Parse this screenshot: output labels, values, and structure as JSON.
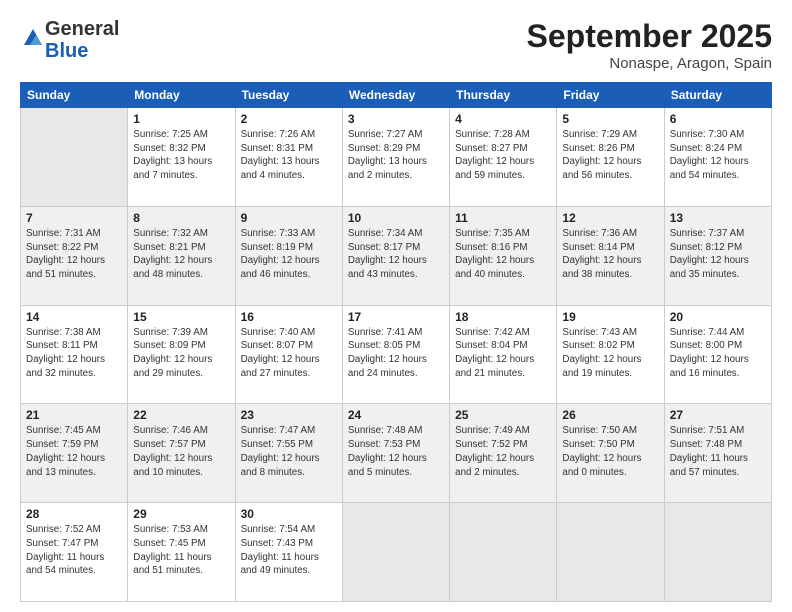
{
  "header": {
    "logo_general": "General",
    "logo_blue": "Blue",
    "month_title": "September 2025",
    "location": "Nonaspe, Aragon, Spain"
  },
  "weekdays": [
    "Sunday",
    "Monday",
    "Tuesday",
    "Wednesday",
    "Thursday",
    "Friday",
    "Saturday"
  ],
  "rows": [
    {
      "cells": [
        {
          "empty": true
        },
        {
          "day": "1",
          "sunrise": "7:25 AM",
          "sunset": "8:32 PM",
          "daylight": "13 hours and 7 minutes."
        },
        {
          "day": "2",
          "sunrise": "7:26 AM",
          "sunset": "8:31 PM",
          "daylight": "13 hours and 4 minutes."
        },
        {
          "day": "3",
          "sunrise": "7:27 AM",
          "sunset": "8:29 PM",
          "daylight": "13 hours and 2 minutes."
        },
        {
          "day": "4",
          "sunrise": "7:28 AM",
          "sunset": "8:27 PM",
          "daylight": "12 hours and 59 minutes."
        },
        {
          "day": "5",
          "sunrise": "7:29 AM",
          "sunset": "8:26 PM",
          "daylight": "12 hours and 56 minutes."
        },
        {
          "day": "6",
          "sunrise": "7:30 AM",
          "sunset": "8:24 PM",
          "daylight": "12 hours and 54 minutes."
        }
      ]
    },
    {
      "cells": [
        {
          "day": "7",
          "sunrise": "7:31 AM",
          "sunset": "8:22 PM",
          "daylight": "12 hours and 51 minutes."
        },
        {
          "day": "8",
          "sunrise": "7:32 AM",
          "sunset": "8:21 PM",
          "daylight": "12 hours and 48 minutes."
        },
        {
          "day": "9",
          "sunrise": "7:33 AM",
          "sunset": "8:19 PM",
          "daylight": "12 hours and 46 minutes."
        },
        {
          "day": "10",
          "sunrise": "7:34 AM",
          "sunset": "8:17 PM",
          "daylight": "12 hours and 43 minutes."
        },
        {
          "day": "11",
          "sunrise": "7:35 AM",
          "sunset": "8:16 PM",
          "daylight": "12 hours and 40 minutes."
        },
        {
          "day": "12",
          "sunrise": "7:36 AM",
          "sunset": "8:14 PM",
          "daylight": "12 hours and 38 minutes."
        },
        {
          "day": "13",
          "sunrise": "7:37 AM",
          "sunset": "8:12 PM",
          "daylight": "12 hours and 35 minutes."
        }
      ]
    },
    {
      "cells": [
        {
          "day": "14",
          "sunrise": "7:38 AM",
          "sunset": "8:11 PM",
          "daylight": "12 hours and 32 minutes."
        },
        {
          "day": "15",
          "sunrise": "7:39 AM",
          "sunset": "8:09 PM",
          "daylight": "12 hours and 29 minutes."
        },
        {
          "day": "16",
          "sunrise": "7:40 AM",
          "sunset": "8:07 PM",
          "daylight": "12 hours and 27 minutes."
        },
        {
          "day": "17",
          "sunrise": "7:41 AM",
          "sunset": "8:05 PM",
          "daylight": "12 hours and 24 minutes."
        },
        {
          "day": "18",
          "sunrise": "7:42 AM",
          "sunset": "8:04 PM",
          "daylight": "12 hours and 21 minutes."
        },
        {
          "day": "19",
          "sunrise": "7:43 AM",
          "sunset": "8:02 PM",
          "daylight": "12 hours and 19 minutes."
        },
        {
          "day": "20",
          "sunrise": "7:44 AM",
          "sunset": "8:00 PM",
          "daylight": "12 hours and 16 minutes."
        }
      ]
    },
    {
      "cells": [
        {
          "day": "21",
          "sunrise": "7:45 AM",
          "sunset": "7:59 PM",
          "daylight": "12 hours and 13 minutes."
        },
        {
          "day": "22",
          "sunrise": "7:46 AM",
          "sunset": "7:57 PM",
          "daylight": "12 hours and 10 minutes."
        },
        {
          "day": "23",
          "sunrise": "7:47 AM",
          "sunset": "7:55 PM",
          "daylight": "12 hours and 8 minutes."
        },
        {
          "day": "24",
          "sunrise": "7:48 AM",
          "sunset": "7:53 PM",
          "daylight": "12 hours and 5 minutes."
        },
        {
          "day": "25",
          "sunrise": "7:49 AM",
          "sunset": "7:52 PM",
          "daylight": "12 hours and 2 minutes."
        },
        {
          "day": "26",
          "sunrise": "7:50 AM",
          "sunset": "7:50 PM",
          "daylight": "12 hours and 0 minutes."
        },
        {
          "day": "27",
          "sunrise": "7:51 AM",
          "sunset": "7:48 PM",
          "daylight": "11 hours and 57 minutes."
        }
      ]
    },
    {
      "cells": [
        {
          "day": "28",
          "sunrise": "7:52 AM",
          "sunset": "7:47 PM",
          "daylight": "11 hours and 54 minutes."
        },
        {
          "day": "29",
          "sunrise": "7:53 AM",
          "sunset": "7:45 PM",
          "daylight": "11 hours and 51 minutes."
        },
        {
          "day": "30",
          "sunrise": "7:54 AM",
          "sunset": "7:43 PM",
          "daylight": "11 hours and 49 minutes."
        },
        {
          "empty": true
        },
        {
          "empty": true
        },
        {
          "empty": true
        },
        {
          "empty": true
        }
      ]
    }
  ]
}
